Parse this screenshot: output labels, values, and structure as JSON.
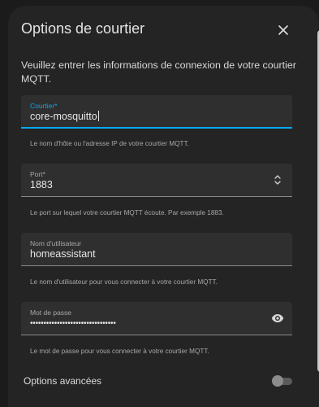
{
  "dialog": {
    "title": "Options de courtier",
    "description": "Veuillez entrer les informations de connexion de votre courtier MQTT.",
    "close_icon": "close-icon"
  },
  "fields": {
    "broker": {
      "label": "Courtier*",
      "value": "core-mosquitto",
      "helper": "Le nom d'hôte ou l'adresse IP de votre courtier MQTT."
    },
    "port": {
      "label": "Port*",
      "value": "1883",
      "helper": "Le port sur lequel votre courtier MQTT écoute. Par exemple 1883.",
      "icon": "spinner-arrows-icon"
    },
    "username": {
      "label": "Nom d'utilisateur",
      "value": "homeassistant",
      "helper": "Le nom d'utilisateur pour vous connecter à votre courtier MQTT."
    },
    "password": {
      "label": "Mot de passe",
      "value": "••••••••••••••••••••••••••••••••",
      "helper": "Le mot de passe pour vous connecter à votre courtier MQTT.",
      "icon": "eye-icon"
    }
  },
  "advanced": {
    "label": "Options avancées",
    "enabled": false
  },
  "colors": {
    "accent": "#03a9f4",
    "surface": "#242424",
    "field_bg": "#2f2f2f"
  }
}
